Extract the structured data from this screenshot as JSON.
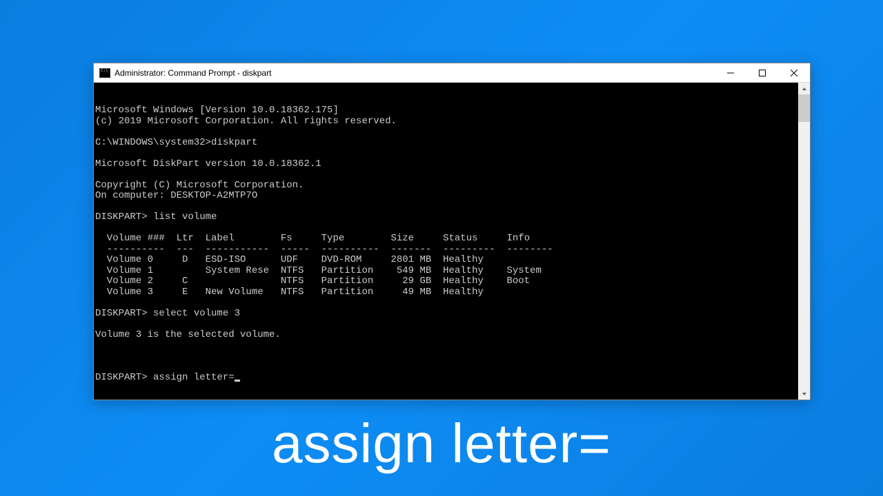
{
  "window": {
    "title": "Administrator: Command Prompt - diskpart"
  },
  "terminal": {
    "lines": [
      "Microsoft Windows [Version 10.0.18362.175]",
      "(c) 2019 Microsoft Corporation. All rights reserved.",
      "",
      "C:\\WINDOWS\\system32>diskpart",
      "",
      "Microsoft DiskPart version 10.0.18362.1",
      "",
      "Copyright (C) Microsoft Corporation.",
      "On computer: DESKTOP-A2MTP7O",
      "",
      "DISKPART> list volume",
      "",
      "  Volume ###  Ltr  Label        Fs     Type        Size     Status     Info",
      "  ----------  ---  -----------  -----  ----------  -------  ---------  --------",
      "  Volume 0     D   ESD-ISO      UDF    DVD-ROM     2801 MB  Healthy",
      "  Volume 1         System Rese  NTFS   Partition    549 MB  Healthy    System",
      "  Volume 2     C                NTFS   Partition     29 GB  Healthy    Boot",
      "  Volume 3     E   New Volume   NTFS   Partition     49 MB  Healthy",
      "",
      "DISKPART> select volume 3",
      "",
      "Volume 3 is the selected volume.",
      ""
    ],
    "current_prompt": "DISKPART> ",
    "current_input": "assign letter="
  },
  "caption": "assign letter="
}
